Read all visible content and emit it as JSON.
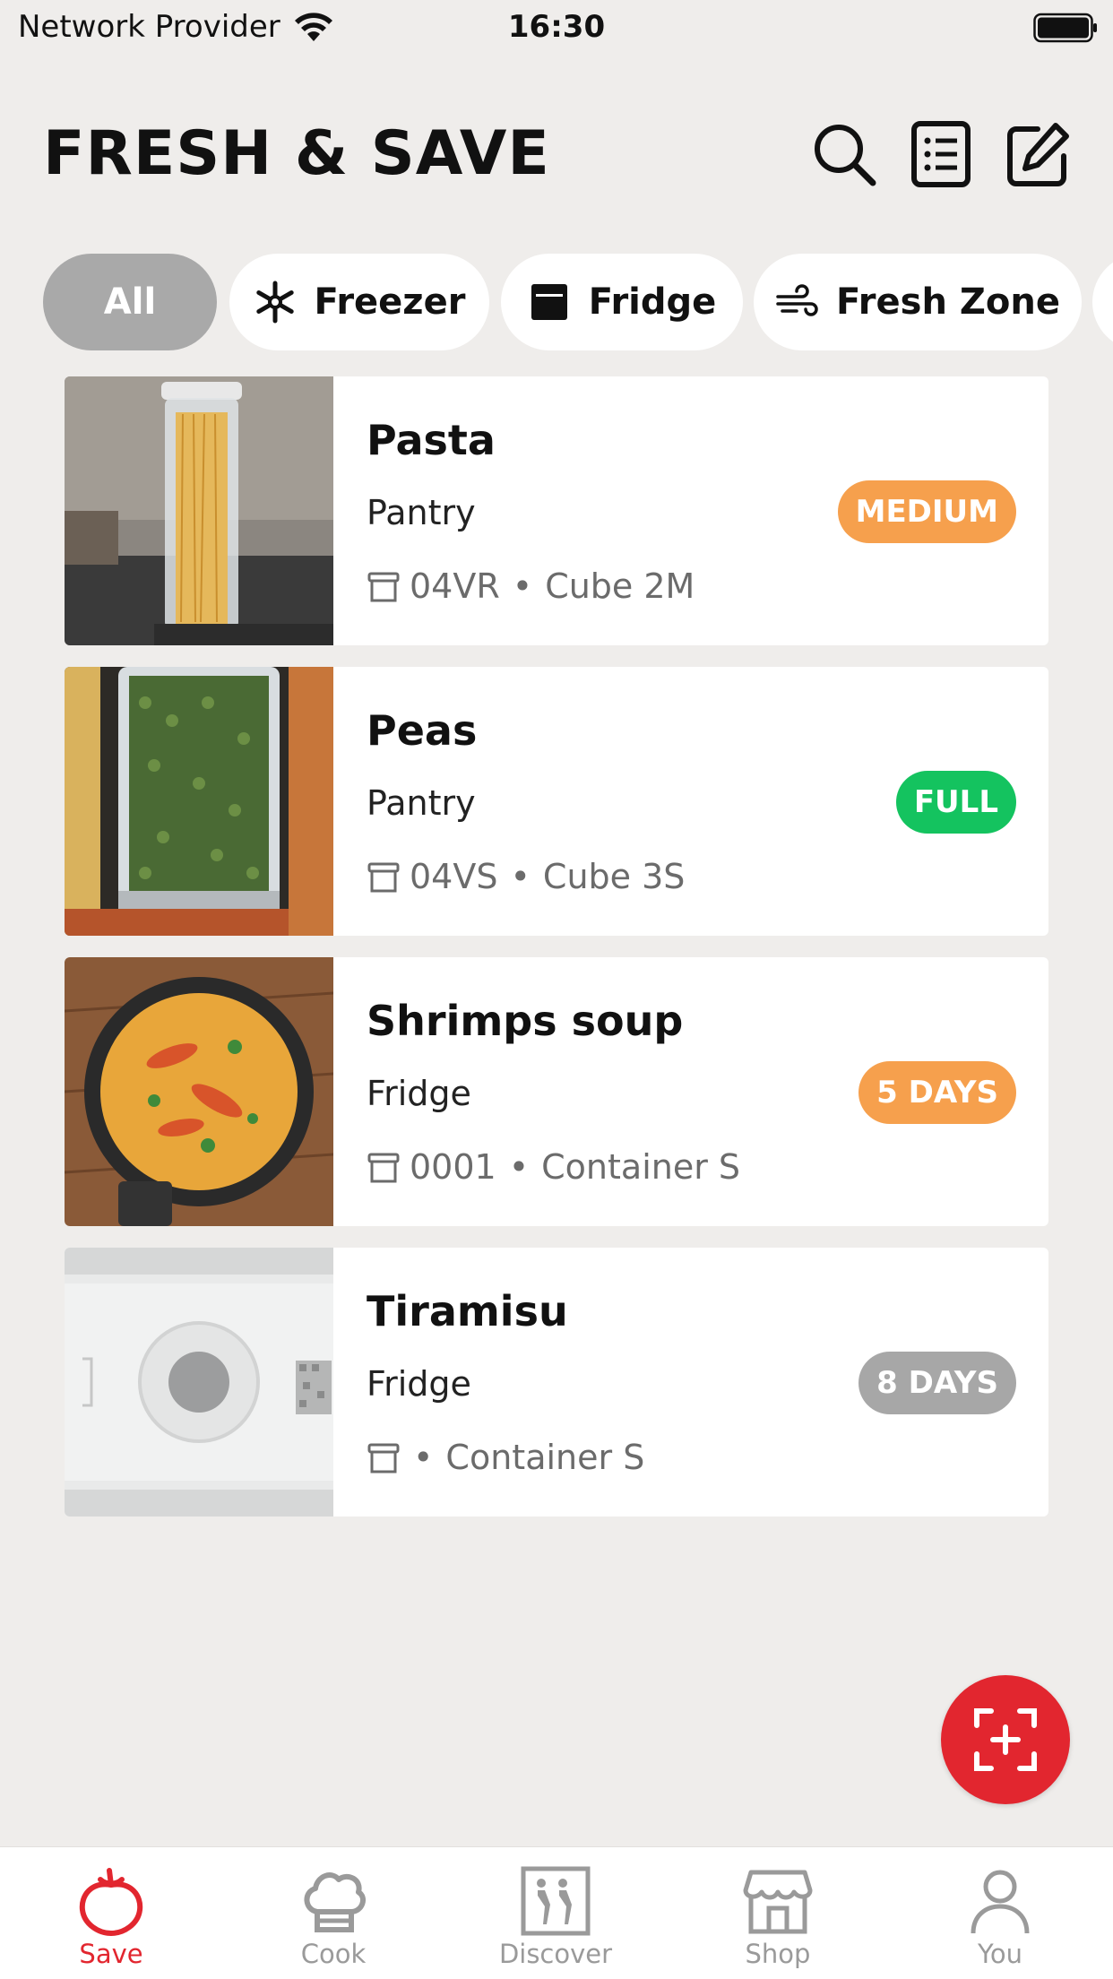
{
  "status_bar": {
    "carrier": "Network Provider",
    "time": "16:30"
  },
  "header": {
    "title": "FRESH & SAVE",
    "icons": [
      "search-icon",
      "list-icon",
      "edit-icon"
    ]
  },
  "filters": [
    {
      "label": "All",
      "icon": null,
      "active": true
    },
    {
      "label": "Freezer",
      "icon": "snowflake-icon",
      "active": false
    },
    {
      "label": "Fridge",
      "icon": "fridge-icon",
      "active": false
    },
    {
      "label": "Fresh Zone",
      "icon": "wind-icon",
      "active": false
    }
  ],
  "items": [
    {
      "title": "Pasta",
      "location": "Pantry",
      "code": "04VR",
      "container": "Cube 2M",
      "badge": "MEDIUM",
      "badge_color": "#f6a04d",
      "image": "pasta-jar"
    },
    {
      "title": "Peas",
      "location": "Pantry",
      "code": "04VS",
      "container": "Cube 3S",
      "badge": "FULL",
      "badge_color": "#14c35f",
      "image": "peas-jar"
    },
    {
      "title": "Shrimps soup",
      "location": "Fridge",
      "code": "0001",
      "container": "Container S",
      "badge": "5 DAYS",
      "badge_color": "#f6a04d",
      "image": "soup-pot"
    },
    {
      "title": "Tiramisu",
      "location": "Fridge",
      "code": "",
      "container": "Container S",
      "badge": "8 DAYS",
      "badge_color": "#a7a7a7",
      "image": "container-lid"
    }
  ],
  "tabs": [
    {
      "label": "Save",
      "icon": "tomato-icon",
      "active": true
    },
    {
      "label": "Cook",
      "icon": "chef-hat-icon",
      "active": false
    },
    {
      "label": "Discover",
      "icon": "brand-logo-icon",
      "active": false
    },
    {
      "label": "Shop",
      "icon": "store-icon",
      "active": false
    },
    {
      "label": "You",
      "icon": "user-icon",
      "active": false
    }
  ],
  "colors": {
    "accent": "#e2262f",
    "background": "#efedeb",
    "muted": "#9a9a9a"
  }
}
